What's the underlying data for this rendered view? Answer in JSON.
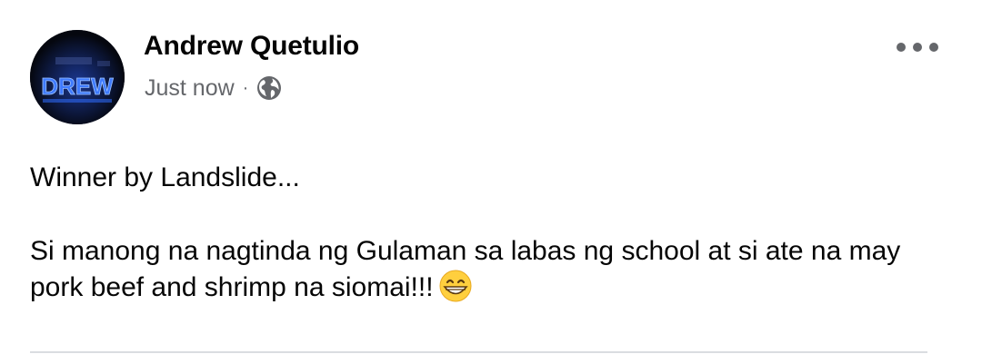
{
  "post": {
    "author": "Andrew Quetulio",
    "timestamp": "Just now",
    "separator": "·",
    "privacy_icon": "globe-icon",
    "more_icon": "more-options-icon",
    "avatar_text": "DREW",
    "body": {
      "line1": "Winner by Landslide...",
      "line2": "Si manong na nagtinda ng Gulaman sa labas ng school at si ate na may pork beef and shrimp na siomai!!!",
      "emoji": "grinning-face-icon"
    }
  },
  "colors": {
    "primary_text": "#050505",
    "secondary_text": "#65676b",
    "divider": "#dadde1",
    "avatar_bg": "#0a0d1e",
    "avatar_accent": "#2f6dff"
  }
}
